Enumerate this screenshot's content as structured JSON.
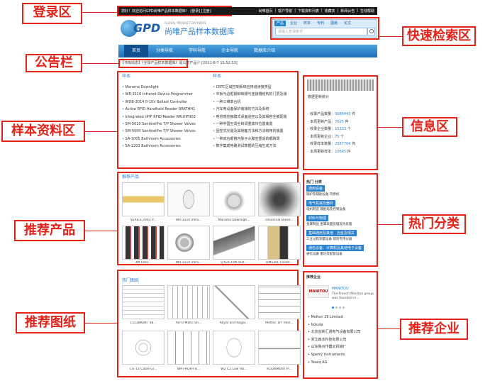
{
  "annotations": {
    "login": "登录区",
    "notice": "公告栏",
    "samples": "样本资料区",
    "recommended_products": "推荐产品",
    "recommended_drawings": "推荐图纸",
    "quick_search": "快速检索区",
    "info": "信息区",
    "hot_categories": "热门分类",
    "recommended_companies": "推荐企业"
  },
  "topbar": {
    "welcome": "您好！欢迎访问GPD尚唯产品样本数据库！",
    "login_link": "[登录]",
    "register_link": "[注册]",
    "links": [
      "尚唯首页",
      "帮户导航",
      "下载资料列表",
      "收藏夹",
      "新闻公告",
      "在线帮助"
    ]
  },
  "logo": {
    "mark": "GPD",
    "name": "尚唯产品样本数据库",
    "en": "GLOBAL PRODUCT DATABASE"
  },
  "search": {
    "tabs": [
      "产品",
      "企业",
      "样本",
      "专利",
      "图纸",
      "论文"
    ],
    "active_tab": "产品",
    "placeholder": "请输入查询条件"
  },
  "nav": {
    "items": [
      "首页",
      "分类导航",
      "学科导航",
      "企业导航",
      "数据库介绍"
    ],
    "active": "首页"
  },
  "notice": {
    "text": "【书库动态】《全球产品样本数据库》是公司产品介 [2011-8-7 15:52:53]"
  },
  "samples": {
    "title_left": "样本",
    "title_right": "样本",
    "left": [
      "Marama Downlight",
      "WR-3110 Infrared Device Programmer",
      "WDB-3014 0-10V Ballast Controller",
      "Active RFID Handheld Reader RRATHH1",
      "Integrated UHF RFID Reader RRUHFR02",
      "SM-5010 SentinelPro T/P Shower Valves",
      "SM-5000 SentinelPro T/P Shower Valves",
      "SA-1005 Bathroom Accessories",
      "SA-1203 Bathroom Accessories"
    ],
    "right": [
      "CBTC区域控制系统应用道读接类型",
      "中板与边框钢铆制槽与连接槽结构的门层及接",
      "一种三维高台机",
      "汽车电设备保护装接的方法及系统",
      "电容感应触摸式桌面遥控以及其相容全被配装",
      "一种中国空调全转调重故块位置装置",
      "固控式光谐及其制备方法和方法和用的装置",
      "一种双右眼镜内脉子水腺宣重适的眼睛罩",
      "数字集成电路测试数据的压缩生成方法"
    ]
  },
  "stats": {
    "title": "数据更新统计",
    "rows": [
      {
        "label": "· 收录产品数量：",
        "value": "3086443",
        "unit": "件"
      },
      {
        "label": "· 本周更新产品：",
        "value": "7025",
        "unit": "件"
      },
      {
        "label": "· 收录企业数量：",
        "value": "15323",
        "unit": "个"
      },
      {
        "label": "· 本周更新企业：",
        "value": "75",
        "unit": "个"
      },
      {
        "label": "· 收录样本数量：",
        "value": "2587704",
        "unit": "件"
      },
      {
        "label": "· 本周更新样本：",
        "value": "10645",
        "unit": "件"
      }
    ]
  },
  "products": {
    "title": "推荐产品",
    "items": [
      "SERIES 2003 P...",
      "WR-3110 Infra...",
      "Marama Downligh...",
      "Universal Diese...",
      "3M Filter...",
      "WR-3110 Infra...",
      "QTEK-25M-5Hz...",
      "DMS30L Foolet..."
    ]
  },
  "drawings": {
    "title": "热门图纸",
    "items": [
      "1553BKBKT 48...",
      "Ad-O-Matic Sh...",
      "Royal and Regal...",
      "Mettec 1R' Rear...",
      "CG-13 Cable Gl...",
      "BMT-HDR-FB...",
      "W2 C2 Low Vol...",
      "ALIGNMENT Pi..."
    ]
  },
  "hot": {
    "title": "热门 分类",
    "cats": [
      {
        "name": "通用设备",
        "sub": "锅炉及辅助设备   内燃机"
      },
      {
        "name": "电气机械及器材",
        "sub": "电机制造   输配电及控制设备"
      },
      {
        "name": "材料与物理",
        "sub": "金属制品   金属表面处理及热处理"
      },
      {
        "name": "基础通用及其他 · 冶金及相关",
        "sub": "工业过程测量设备   建筑专用仪器"
      },
      {
        "name": "通信设备、计算机及其他电子设备",
        "sub": "通信设备   雷达及配套设备"
      }
    ]
  },
  "companies": {
    "title": "推荐企业",
    "featured_name": "MANITOU",
    "featured_desc": "The French Manitou group was founded in...",
    "logo_text": "MANITOU",
    "items": [
      "Molton 29 Limited",
      "fokuda",
      "北京创新汇通电气设备有限公司",
      "浙江森本科技有限公司",
      "山东鲁州作器太机械厂",
      "Sperry Instruments",
      "Teseq AG"
    ]
  }
}
